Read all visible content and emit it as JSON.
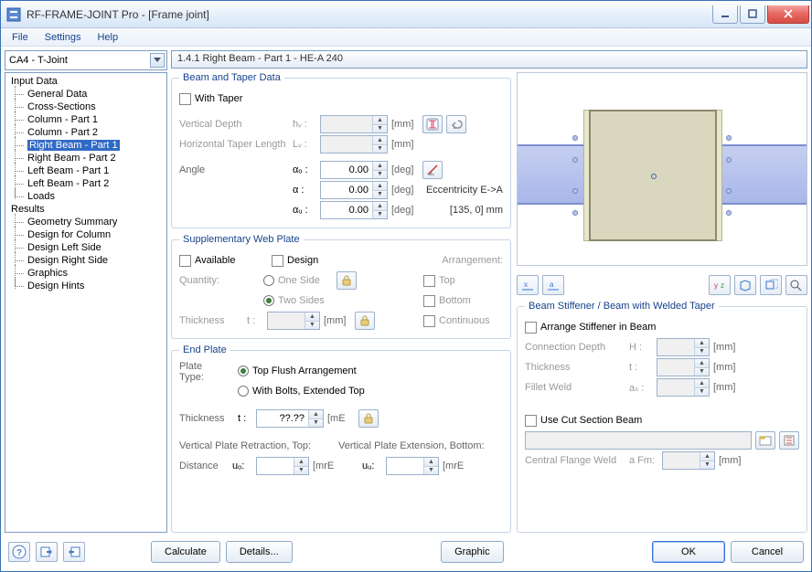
{
  "window": {
    "title": "RF-FRAME-JOINT Pro - [Frame joint]"
  },
  "menu": {
    "file": "File",
    "settings": "Settings",
    "help": "Help"
  },
  "left": {
    "combo": "CA4 - T-Joint",
    "tree": {
      "input": "Input Data",
      "items_input": [
        "General Data",
        "Cross-Sections",
        "Column - Part 1",
        "Column - Part 2",
        "Right Beam - Part 1",
        "Right Beam - Part 2",
        "Left Beam - Part 1",
        "Left Beam - Part 2",
        "Loads"
      ],
      "results": "Results",
      "items_results": [
        "Geometry Summary",
        "Design for Column",
        "Design Left Side",
        "Design Right Side",
        "Graphics",
        "Design Hints"
      ],
      "selected_index": 4
    }
  },
  "section_title": "1.4.1 Right Beam - Part 1 - HE-A 240",
  "beam_taper": {
    "legend": "Beam and Taper Data",
    "with_taper": "With Taper",
    "vdepth": "Vertical Depth",
    "vdepth_sym": "hᵥ :",
    "mm": "[mm]",
    "hlen": "Horizontal Taper Length",
    "hlen_sym": "Lᵥ :",
    "angle": "Angle",
    "ao_sym": "αₒ :",
    "a_sym": "α :",
    "au_sym": "αᵤ :",
    "deg": "[deg]",
    "ao": "0.00",
    "a": "0.00",
    "au": "0.00",
    "ecc_label": "Eccentricity E->A",
    "ecc_val": "[135, 0] mm"
  },
  "web": {
    "legend": "Supplementary Web Plate",
    "available": "Available",
    "design": "Design",
    "arrangement": "Arrangement:",
    "quantity": "Quantity:",
    "one": "One Side",
    "two": "Two Sides",
    "top": "Top",
    "bottom": "Bottom",
    "continuous": "Continuous",
    "thickness": "Thickness",
    "t_sym": "t :",
    "mm": "[mm]"
  },
  "end_plate": {
    "legend": "End Plate",
    "plate_type": "Plate\nType:",
    "top_flush": "Top Flush Arrangement",
    "bolts_ext": "With Bolts, Extended Top",
    "thickness": "Thickness",
    "t_sym": "t :",
    "t_val": "??.??",
    "t_unit": "[mE",
    "vpr": "Vertical Plate Retraction, Top:",
    "vpe": "Vertical Plate Extension, Bottom:",
    "distance": "Distance",
    "uo": "uₒ:",
    "uu": "uᵤ:",
    "mrE": "[mrE"
  },
  "stiffener": {
    "legend": "Beam Stiffener / Beam with Welded Taper",
    "arrange": "Arrange Stiffener in Beam",
    "conn_depth": "Connection Depth",
    "H": "H :",
    "thickness": "Thickness",
    "t": "t :",
    "fillet": "Fillet Weld",
    "as": "aₛ :",
    "mm": "[mm]",
    "cut": "Use Cut Section Beam",
    "cfw": "Central Flange Weld",
    "aFm": "a Fm:"
  },
  "footer": {
    "calculate": "Calculate",
    "details": "Details...",
    "graphic": "Graphic",
    "ok": "OK",
    "cancel": "Cancel"
  }
}
